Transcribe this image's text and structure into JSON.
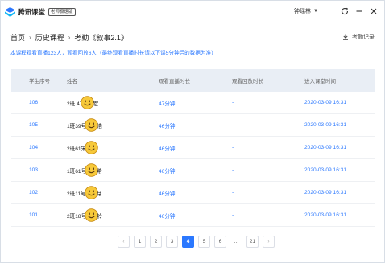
{
  "app": {
    "name": "腾讯课堂",
    "badge": "老师极速版"
  },
  "titlebar": {
    "user": "钟瑶林"
  },
  "breadcrumb": {
    "items": [
      "首页",
      "历史课程",
      "考勤《叙事2.1》"
    ]
  },
  "export_label": "考勤记录",
  "summary": "本课程观看直播123人，观看回放6人（最终观看直播时长请以下课5分钟后的数据为准）",
  "table": {
    "headers": [
      "学生序号",
      "姓名",
      "观看直播时长",
      "观看回放时长",
      "进入课堂时间"
    ],
    "rows": [
      {
        "id": "106",
        "name_pre": "2班 47",
        "name_post": "宏",
        "live": "47分钟",
        "replay": "-",
        "enter": "2020-03-09 16:31"
      },
      {
        "id": "105",
        "name_pre": "1班39号",
        "name_post": "浩",
        "live": "46分钟",
        "replay": "-",
        "enter": "2020-03-09 16:31"
      },
      {
        "id": "104",
        "name_pre": "2班61宋",
        "name_post": "",
        "live": "46分钟",
        "replay": "-",
        "enter": "2020-03-09 16:31"
      },
      {
        "id": "103",
        "name_pre": "1班61号",
        "name_post": "希",
        "live": "46分钟",
        "replay": "-",
        "enter": "2020-03-09 16:31"
      },
      {
        "id": "102",
        "name_pre": "2班11号",
        "name_post": "芽",
        "live": "46分钟",
        "replay": "-",
        "enter": "2020-03-09 16:31"
      },
      {
        "id": "101",
        "name_pre": "2班18号",
        "name_post": "铃",
        "live": "46分钟",
        "replay": "-",
        "enter": "2020-03-09 16:31"
      }
    ]
  },
  "pagination": {
    "prev": "‹",
    "pages": [
      "1",
      "2",
      "3",
      "4",
      "5",
      "6",
      "...",
      "21"
    ],
    "current": "4",
    "next": "›"
  },
  "colors": {
    "accent": "#2b78ff",
    "header_bg": "#e9eef5"
  }
}
